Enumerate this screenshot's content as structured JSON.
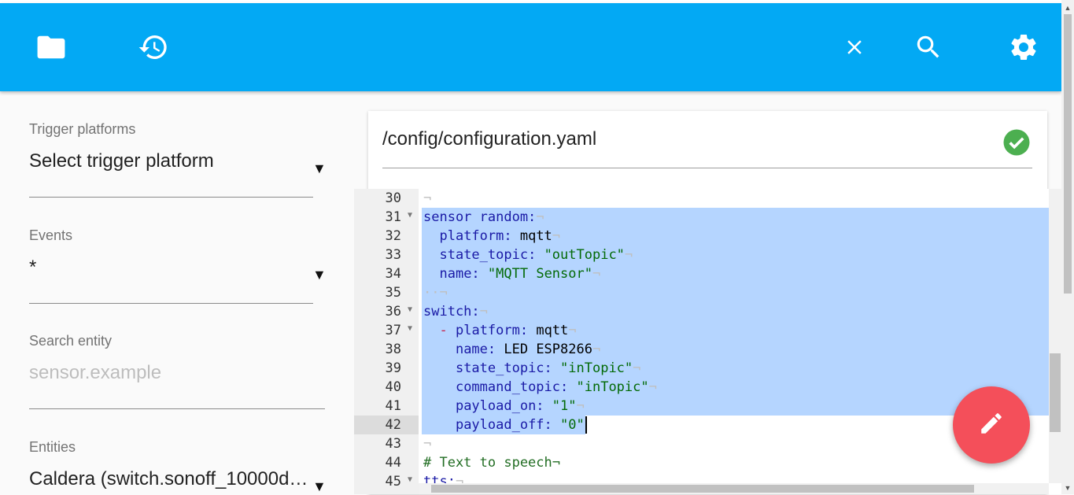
{
  "toolbar": {
    "left_icons": [
      "folder-icon",
      "history-icon"
    ],
    "right_icons": [
      "close-icon",
      "search-icon",
      "settings-icon"
    ],
    "background_color": "#03a9f4"
  },
  "sidebar": {
    "trigger_platforms": {
      "label": "Trigger platforms",
      "value": "Select trigger platform"
    },
    "events": {
      "label": "Events",
      "value": "*"
    },
    "search_entity": {
      "label": "Search entity",
      "placeholder": "sensor.example"
    },
    "entities": {
      "label": "Entities",
      "value": "Caldera (switch.sonoff_10000d…"
    }
  },
  "editor_card": {
    "file_path": "/config/configuration.yaml",
    "status_icon": "check-circle-icon",
    "status_color": "#4caf50"
  },
  "code": {
    "lines": [
      {
        "n": "30",
        "fold": false,
        "text": "¬"
      },
      {
        "n": "31",
        "fold": true,
        "text": "sensor random:¬"
      },
      {
        "n": "32",
        "fold": false,
        "text": "  platform: mqtt¬"
      },
      {
        "n": "33",
        "fold": false,
        "text": "  state_topic: \"outTopic\"¬"
      },
      {
        "n": "34",
        "fold": false,
        "text": "  name: \"MQTT Sensor\"¬"
      },
      {
        "n": "35",
        "fold": false,
        "text": "··¬"
      },
      {
        "n": "36",
        "fold": true,
        "text": "switch:¬"
      },
      {
        "n": "37",
        "fold": true,
        "text": "  - platform: mqtt¬"
      },
      {
        "n": "38",
        "fold": false,
        "text": "    name: LED ESP8266¬"
      },
      {
        "n": "39",
        "fold": false,
        "text": "    state_topic: \"inTopic\"¬"
      },
      {
        "n": "40",
        "fold": false,
        "text": "    command_topic: \"inTopic\"¬"
      },
      {
        "n": "41",
        "fold": false,
        "text": "    payload_on: \"1\"¬"
      },
      {
        "n": "42",
        "fold": false,
        "text": "    payload_off: \"0\""
      },
      {
        "n": "43",
        "fold": false,
        "text": "¬"
      },
      {
        "n": "44",
        "fold": false,
        "text": "# Text to speech¬"
      },
      {
        "n": "45",
        "fold": true,
        "text": "tts:¬"
      }
    ],
    "active_line": "42"
  },
  "fab": {
    "icon": "pencil-icon",
    "color": "#f44f5a"
  }
}
